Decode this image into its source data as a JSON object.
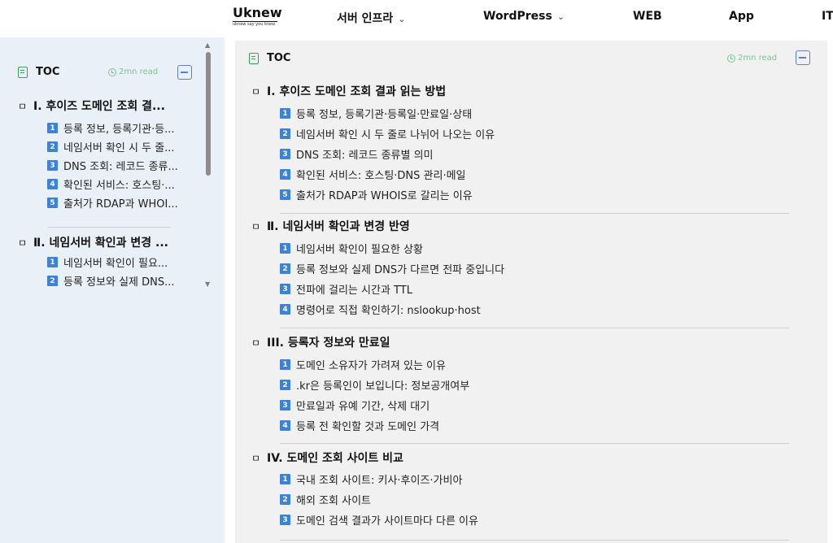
{
  "logo": {
    "name": "Uknew",
    "tagline": "uknew say you knew"
  },
  "nav": [
    {
      "label": "서버 인프라",
      "chevron": true
    },
    {
      "label": "WordPress",
      "chevron": true
    },
    {
      "label": "WEB",
      "chevron": false
    },
    {
      "label": "App",
      "chevron": false
    },
    {
      "label": "IT",
      "chevron": false
    }
  ],
  "toc": {
    "title": "TOC",
    "read_time": "2mn read",
    "sections": [
      {
        "title": "Ⅰ. 후이즈 도메인 조회 결과 읽는 방법",
        "short": "Ⅰ. 후이즈 도메인 조회 결...",
        "items": [
          {
            "n": "1",
            "label": "등록 정보, 등록기관·등록일·만료일·상태",
            "short": "등록 정보, 등록기관·등..."
          },
          {
            "n": "2",
            "label": "네임서버 확인 시 두 줄로 나뉘어 나오는 이유",
            "short": "네임서버 확인 시 두 줄..."
          },
          {
            "n": "3",
            "label": "DNS 조회: 레코드 종류별 의미",
            "short": "DNS 조회: 레코드 종류..."
          },
          {
            "n": "4",
            "label": "확인된 서비스: 호스팅·DNS 관리·메일",
            "short": "확인된 서비스: 호스팅·..."
          },
          {
            "n": "5",
            "label": "출처가 RDAP과 WHOIS로 갈리는 이유",
            "short": "출처가 RDAP과 WHOI..."
          }
        ]
      },
      {
        "title": "Ⅱ. 네임서버 확인과 변경 반영",
        "short": "Ⅱ. 네임서버 확인과 변경 ...",
        "items": [
          {
            "n": "1",
            "label": "네임서버 확인이 필요한 상황",
            "short": "네임서버 확인이 필요..."
          },
          {
            "n": "2",
            "label": "등록 정보와 실제 DNS가 다르면 전파 중입니다",
            "short": "등록 정보와 실제 DNS..."
          },
          {
            "n": "3",
            "label": "전파에 걸리는 시간과 TTL"
          },
          {
            "n": "4",
            "label": "명령어로 직접 확인하기: nslookup·host"
          }
        ]
      },
      {
        "title": "III. 등록자 정보와 만료일",
        "items": [
          {
            "n": "1",
            "label": "도메인 소유자가 가려져 있는 이유"
          },
          {
            "n": "2",
            "label": ".kr은 등록인이 보입니다: 정보공개여부"
          },
          {
            "n": "3",
            "label": "만료일과 유예 기간, 삭제 대기"
          },
          {
            "n": "4",
            "label": "등록 전 확인할 것과 도메인 가격"
          }
        ]
      },
      {
        "title": "IV. 도메인 조회 사이트 비교",
        "items": [
          {
            "n": "1",
            "label": "국내 조회 사이트: 키사·후이즈·가비아"
          },
          {
            "n": "2",
            "label": "해외 조회 사이트"
          },
          {
            "n": "3",
            "label": "도메인 검색 결과가 사이트마다 다른 이유"
          }
        ]
      }
    ]
  },
  "section_glyph": "ㅁ",
  "colors": {
    "accent": "#3c82d6",
    "toc_green": "#3aa35b",
    "read_green": "#7cc58f",
    "sidebar_bg": "#eaf0f7",
    "panel_bg": "#f1f1f1"
  }
}
